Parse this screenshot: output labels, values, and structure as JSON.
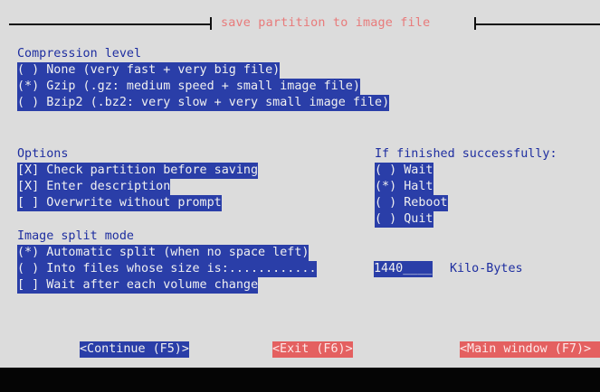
{
  "dialog": {
    "title": "save partition to image file"
  },
  "compression": {
    "heading": "Compression level",
    "options": [
      "( ) None (very fast + very big file)",
      "(*) Gzip (.gz: medium speed + small image file)",
      "( ) Bzip2 (.bz2: very slow + very small image file)"
    ],
    "selected": "Gzip"
  },
  "options": {
    "heading": "Options",
    "items": [
      "[X] Check partition before saving",
      "[X] Enter description",
      "[ ] Overwrite without prompt"
    ]
  },
  "finished": {
    "heading": "If finished successfully:",
    "items": [
      "( ) Wait",
      "(*) Halt",
      "( ) Reboot",
      "( ) Quit"
    ],
    "selected": "Halt"
  },
  "split": {
    "heading": "Image split mode",
    "items": [
      "(*) Automatic split (when no space left)",
      "( ) Into files whose size is:............",
      "[ ] Wait after each volume change"
    ],
    "size_value": "1440____",
    "size_unit": "Kilo-Bytes"
  },
  "buttons": {
    "continue": "<Continue (F5)>",
    "exit": "<Exit (F6)>",
    "main_window": "<Main window (F7)>"
  },
  "colors": {
    "background": "#dcdcdc",
    "highlight": "#2a3ea8",
    "text": "#1e2ea0",
    "title": "#e87a7a",
    "inactive_button": "#e46060"
  }
}
